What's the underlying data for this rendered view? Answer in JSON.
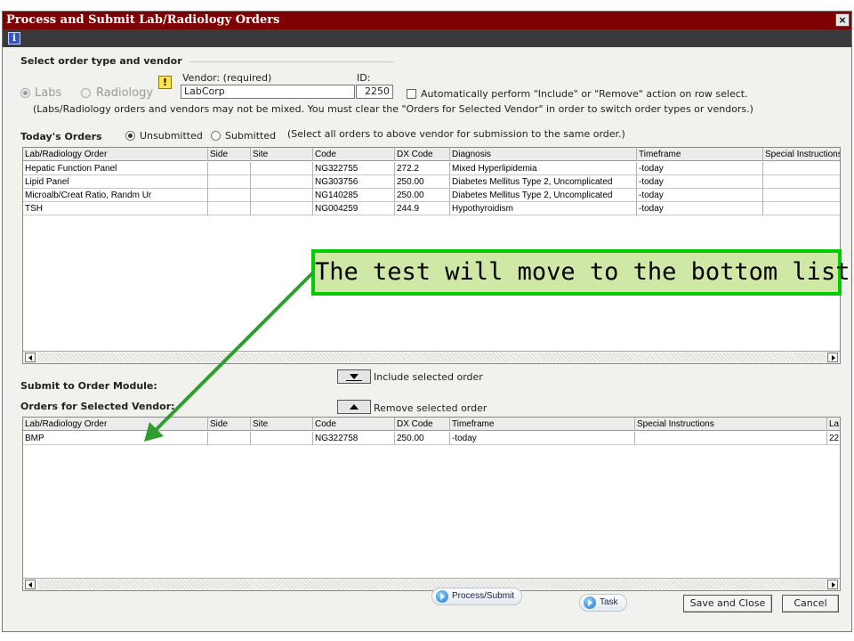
{
  "window": {
    "title": "Process and Submit Lab/Radiology Orders",
    "close_label": "×"
  },
  "toolbar": {
    "info_label": "i"
  },
  "order_type": {
    "legend": "Select order type and vendor",
    "labs_label": "Labs",
    "radiology_label": "Radiology",
    "warning_label": "!",
    "vendor_label": "Vendor: (required)",
    "vendor_value": "LabCorp",
    "id_label": "ID:",
    "id_value": "2250",
    "auto_label": "Automatically perform \"Include\" or \"Remove\" action on row select.",
    "note": "(Labs/Radiology orders and vendors may not be mixed. You must clear the \"Orders for Selected Vendor\" in order to switch order types or vendors.)"
  },
  "todays_orders": {
    "title": "Today's Orders",
    "unsubmitted_label": "Unsubmitted",
    "submitted_label": "Submitted",
    "hint": "(Select all orders to above vendor for submission to the same order.)",
    "columns": [
      "Lab/Radiology Order",
      "Side",
      "Site",
      "Code",
      "DX Code",
      "Diagnosis",
      "Timeframe",
      "Special Instructions"
    ],
    "rows": [
      [
        "Hepatic Function Panel",
        "",
        "",
        "NG322755",
        "272.2",
        "Mixed Hyperlipidemia",
        "-today",
        ""
      ],
      [
        "Lipid Panel",
        "",
        "",
        "NG303756",
        "250.00",
        "Diabetes Mellitus Type 2, Uncomplicated",
        "-today",
        ""
      ],
      [
        "Microalb/Creat Ratio, Randm Ur",
        "",
        "",
        "NG140285",
        "250.00",
        "Diabetes Mellitus Type 2, Uncomplicated",
        "-today",
        ""
      ],
      [
        "TSH",
        "",
        "",
        "NG004259",
        "244.9",
        "Hypothyroidism",
        "-today",
        ""
      ]
    ]
  },
  "actions": {
    "include_label": "Include selected order",
    "remove_label": "Remove selected order"
  },
  "submit": {
    "title": "Submit to Order Module:",
    "vendor_orders_title": "Orders for Selected Vendor:",
    "columns": [
      "Lab/Radiology Order",
      "Side",
      "Site",
      "Code",
      "DX Code",
      "Timeframe",
      "Special Instructions",
      "La"
    ],
    "rows": [
      [
        "BMP",
        "",
        "",
        "NG322758",
        "250.00",
        "-today",
        "",
        "22"
      ]
    ]
  },
  "footer": {
    "process_label": "Process/Submit",
    "task_label": "Task",
    "save_label": "Save and Close",
    "cancel_label": "Cancel"
  },
  "callout": {
    "text": "The test will move to the bottom list."
  },
  "colors": {
    "titlebar": "#7e0000",
    "callout_border": "#00cc00",
    "callout_fill": "#cfe8a6",
    "arrow": "#2e9e2e"
  }
}
